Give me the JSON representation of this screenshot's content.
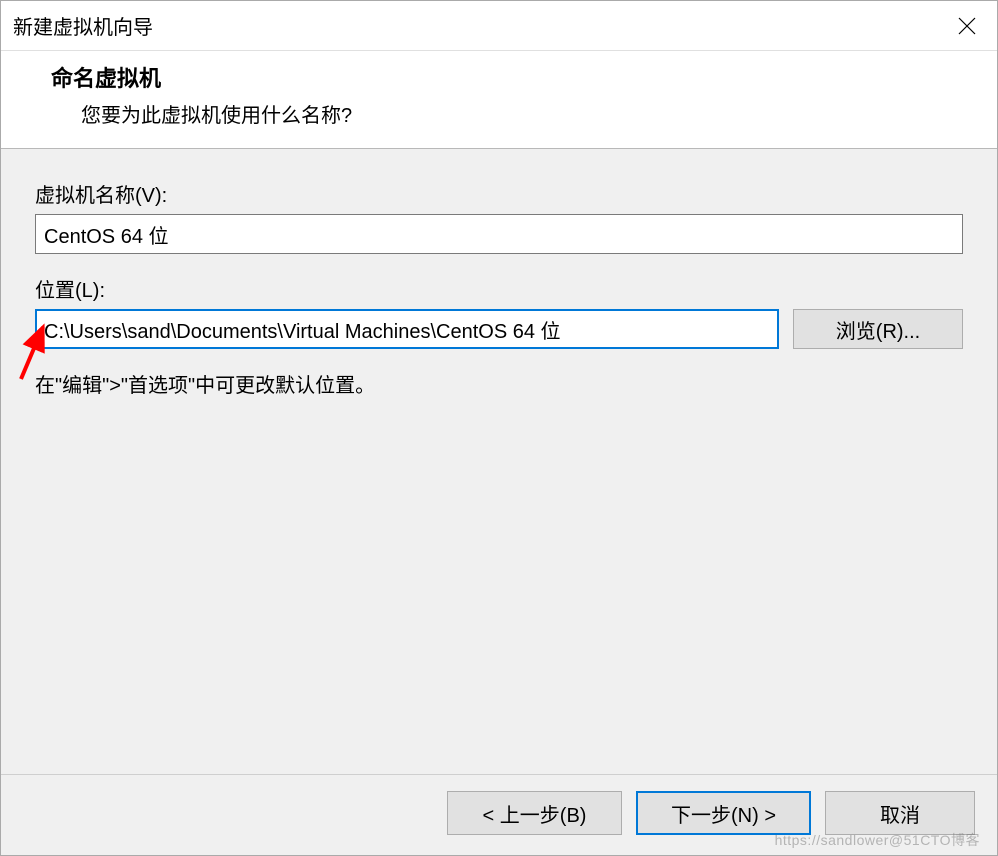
{
  "window": {
    "title": "新建虚拟机向导"
  },
  "header": {
    "title": "命名虚拟机",
    "subtitle": "您要为此虚拟机使用什么名称?"
  },
  "fields": {
    "name_label": "虚拟机名称(V):",
    "name_value": "CentOS 64 位",
    "location_label": "位置(L):",
    "location_value": "C:\\Users\\sand\\Documents\\Virtual Machines\\CentOS 64 位",
    "browse_label": "浏览(R)..."
  },
  "hint": "在\"编辑\">\"首选项\"中可更改默认位置。",
  "buttons": {
    "back": "< 上一步(B)",
    "next": "下一步(N) >",
    "cancel": "取消"
  },
  "watermark": "https://sandlower@51CTO博客",
  "icons": {
    "close": "close-icon"
  },
  "annotation": {
    "arrow_color": "#ff0000"
  }
}
